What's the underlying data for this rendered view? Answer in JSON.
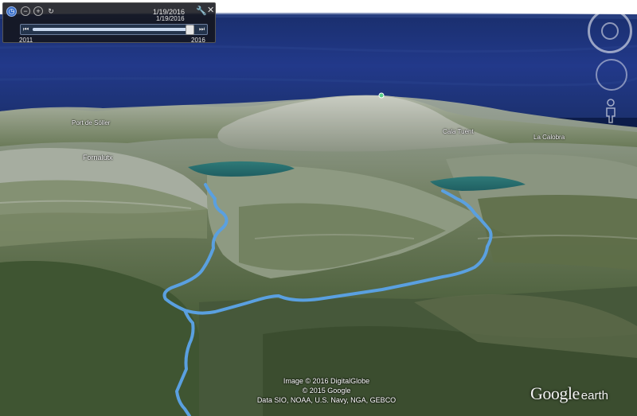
{
  "time_slider": {
    "top_date": "1/19/2016",
    "current_date": "1/19/2016",
    "range_start": "2011",
    "range_end": "2016",
    "position_fraction": 0.98
  },
  "toolbar_icons": {
    "clock": "clock-icon",
    "zoom_out": "zoom-out-icon",
    "zoom_in": "zoom-in-icon",
    "refresh": "refresh-icon",
    "settings": "wrench-icon",
    "close": "close-icon"
  },
  "labels": {
    "fornalutx": "Fornalutx",
    "port_de_soller": "Port de Sóller",
    "cala_tuent": "Cala Tuent",
    "la_calobra": "La Calobra"
  },
  "attribution": {
    "line1": "Image © 2016 DigitalGlobe",
    "line2": "© 2015 Google",
    "line3": "Data SIO, NOAA, U.S. Navy, NGA, GEBCO"
  },
  "logo": {
    "google": "Google",
    "earth": "earth"
  },
  "colors": {
    "track": "#5aa0e0",
    "sea": "#1d347a",
    "sky": "#ffffff"
  }
}
